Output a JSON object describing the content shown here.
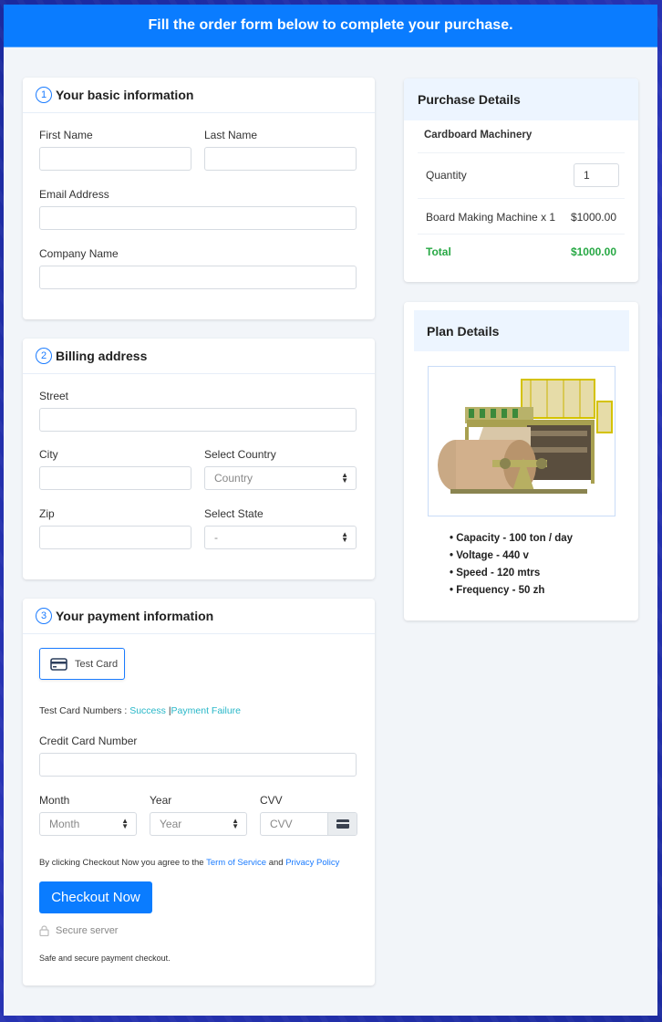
{
  "header": {
    "title": "Fill the order form below to complete your purchase."
  },
  "basic_info": {
    "step": "1",
    "title": "Your basic information",
    "first_name_label": "First Name",
    "first_name_value": "",
    "last_name_label": "Last Name",
    "last_name_value": "",
    "email_label": "Email Address",
    "email_value": "",
    "company_label": "Company Name",
    "company_value": ""
  },
  "billing": {
    "step": "2",
    "title": "Billing address",
    "street_label": "Street",
    "city_label": "City",
    "country_label": "Select Country",
    "country_value": "Country",
    "zip_label": "Zip",
    "state_label": "Select State",
    "state_value": "-"
  },
  "payment": {
    "step": "3",
    "title": "Your payment information",
    "method_label": "Test Card",
    "test_numbers_label": "Test Card Numbers :",
    "success_link": "Success",
    "divider": "|",
    "failure_link": "Payment Failure",
    "card_number_label": "Credit Card Number",
    "month_label": "Month",
    "month_value": "Month",
    "year_label": "Year",
    "year_value": "Year",
    "cvv_label": "CVV",
    "cvv_placeholder": "CVV",
    "agree_prefix": "By clicking Checkout Now you agree to the",
    "tos_link": "Term of Service",
    "agree_and": "and",
    "privacy_link": "Privacy Policy",
    "checkout_button": "Checkout Now",
    "secure_label": "Secure server",
    "safe_note": "Safe and secure payment checkout."
  },
  "purchase": {
    "title": "Purchase Details",
    "product": "Cardboard Machinery",
    "quantity_label": "Quantity",
    "quantity_value": "1",
    "line_item": "Board Making Machine x 1",
    "line_price": "$1000.00",
    "total_label": "Total",
    "total_value": "$1000.00",
    "total_color": "#27a844"
  },
  "plan": {
    "title": "Plan Details",
    "image_alt": "Board making machine",
    "features": [
      "Capacity - 100 ton / day",
      "Voltage - 440 v",
      "Speed - 120 mtrs",
      "Frequency - 50 zh"
    ]
  },
  "colors": {
    "accent": "#0a7cff",
    "link": "#1a7bff",
    "teal": "#28b7c8",
    "success": "#27a844"
  }
}
